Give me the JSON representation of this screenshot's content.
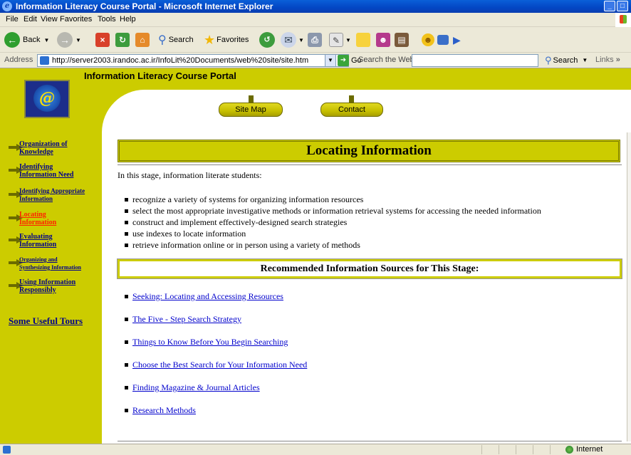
{
  "window": {
    "title": "Information Literacy Course Portal - Microsoft Internet Explorer",
    "buttons": [
      "_",
      "□"
    ]
  },
  "menu": [
    "File",
    "Edit",
    "View",
    "Favorites",
    "Tools",
    "Help"
  ],
  "toolbar": {
    "back_label": "Back",
    "search_label": "Search",
    "favorites_label": "Favorites"
  },
  "address": {
    "label": "Address",
    "url": "http://server2003.irandoc.ac.ir/InfoLit%20Documents/web%20site/site.htm",
    "go_label": "Go",
    "search_web_label": "Search the Web",
    "search_button": "Search",
    "links_label": "Links"
  },
  "portal": {
    "title": "Information Literacy Course Portal",
    "logo_glyph": "@",
    "nav_buttons": [
      "Site Map",
      "Contact"
    ]
  },
  "sidebar": {
    "items": [
      {
        "line1": "Organization of",
        "line2": "Knowledge"
      },
      {
        "line1": "Identifying",
        "line2": "Information Need"
      },
      {
        "line1": "Identifying Appropriate",
        "line2": "Information"
      },
      {
        "line1": "Locating",
        "line2": "Information"
      },
      {
        "line1": "Evaluating",
        "line2": "Information"
      },
      {
        "line1": "Organizing and",
        "line2": "Synthesizing Information"
      },
      {
        "line1": "Using Information",
        "line2": "Responsibly"
      }
    ],
    "tours": "Some Useful Tours"
  },
  "content": {
    "heading": "Locating Information",
    "intro": "In this stage, information literate students:",
    "bullets": [
      "recognize a variety of systems for organizing information resources",
      "select the most appropriate investigative methods or information retrieval systems for accessing the needed information",
      "construct and implement effectively-designed search strategies",
      "use indexes to locate information",
      "retrieve information online or in person using a variety of methods"
    ],
    "sources_heading": "Recommended Information Sources for This Stage:",
    "sources": [
      "Seeking: Locating and Accessing Resources",
      "The Five - Step Search Strategy",
      "Things to Know Before You Begin Searching",
      "Choose the Best Search for Your Information Need",
      "Finding Magazine & Journal Articles",
      "Research Methods"
    ]
  },
  "status": {
    "zone": "Internet"
  }
}
